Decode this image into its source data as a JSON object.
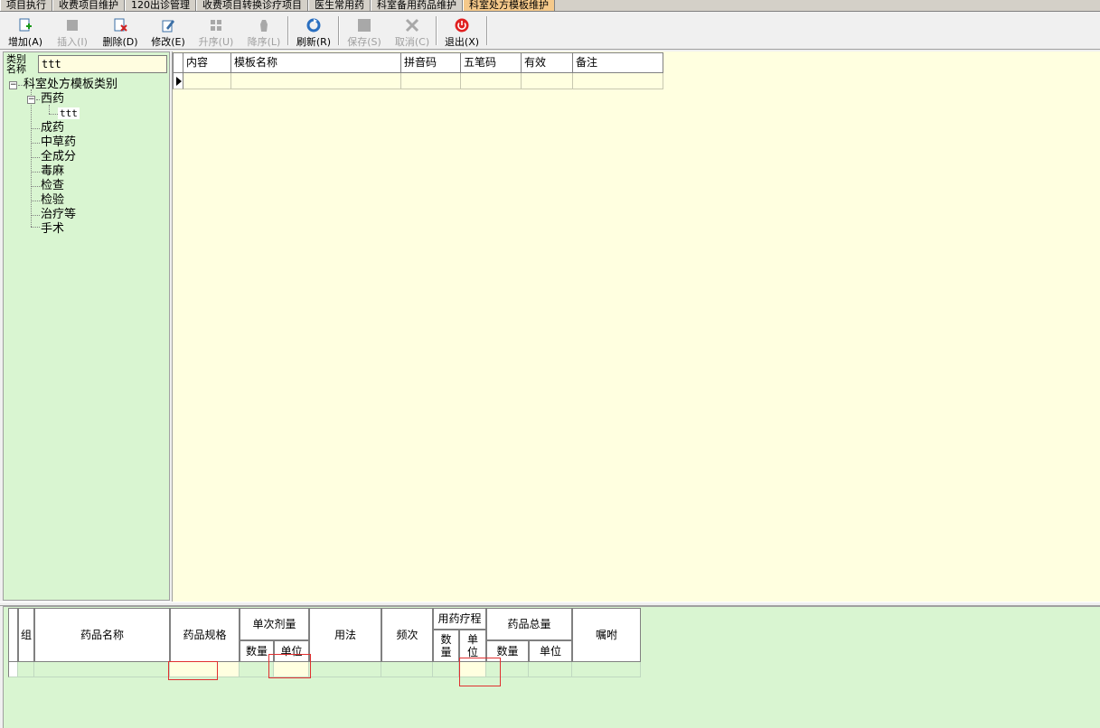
{
  "tabs": [
    {
      "label": "项目执行",
      "active": false
    },
    {
      "label": "收费项目维护",
      "active": false
    },
    {
      "label": "120出诊管理",
      "active": false
    },
    {
      "label": "收费项目转换诊疗项目",
      "active": false
    },
    {
      "label": "医生常用药",
      "active": false
    },
    {
      "label": "科室备用药品维护",
      "active": false
    },
    {
      "label": "科室处方模板维护",
      "active": true
    }
  ],
  "toolbar": {
    "add": "增加(A)",
    "insert": "插入(I)",
    "delete": "删除(D)",
    "modify": "修改(E)",
    "sort_up": "升序(U)",
    "sort_down": "降序(L)",
    "refresh": "刷新(R)",
    "save": "保存(S)",
    "cancel": "取消(C)",
    "exit": "退出(X)"
  },
  "left": {
    "category_label_1": "类别",
    "category_label_2": "名称",
    "category_value": "ttt",
    "tree": {
      "root": "科室处方模板类别",
      "western": "西药",
      "western_child": "ttt",
      "items": [
        "成药",
        "中草药",
        "全成分",
        "毒麻",
        "检查",
        "检验",
        "治疗等",
        "手术"
      ]
    }
  },
  "template_grid": {
    "columns": [
      "内容",
      "模板名称",
      "拼音码",
      "五笔码",
      "有效",
      "备注"
    ]
  },
  "detail_grid": {
    "group": "组",
    "drug_name": "药品名称",
    "drug_spec": "药品规格",
    "single_dose": "单次剂量",
    "single_qty": "数量",
    "single_unit": "单位",
    "usage": "用法",
    "frequency": "频次",
    "course": "用药疗程",
    "course_qty_1": "数",
    "course_qty_2": "量",
    "course_unit_1": "单",
    "course_unit_2": "位",
    "total": "药品总量",
    "total_qty": "数量",
    "total_unit": "单位",
    "advice": "嘱咐"
  },
  "colors": {
    "panel_green": "#d9f5d1",
    "grid_yellow": "#ffffe0",
    "active_tab": "#f5c98a",
    "highlight_red": "#e03030"
  }
}
